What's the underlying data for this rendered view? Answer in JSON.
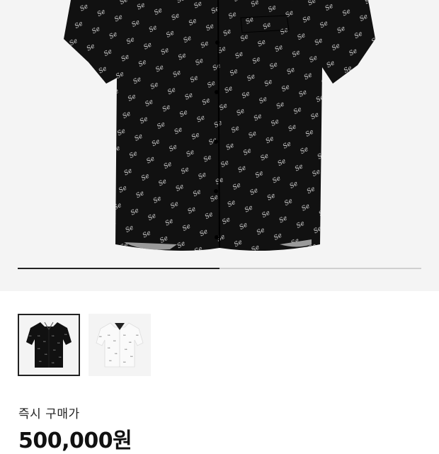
{
  "gallery": {
    "image_alt_icon": "black-patterned-shirt",
    "progress_fraction": 0.5
  },
  "thumbnails": [
    {
      "variant": "black",
      "selected": true
    },
    {
      "variant": "white",
      "selected": false
    }
  ],
  "price": {
    "label": "즉시 구매가",
    "value": "500,000원"
  }
}
